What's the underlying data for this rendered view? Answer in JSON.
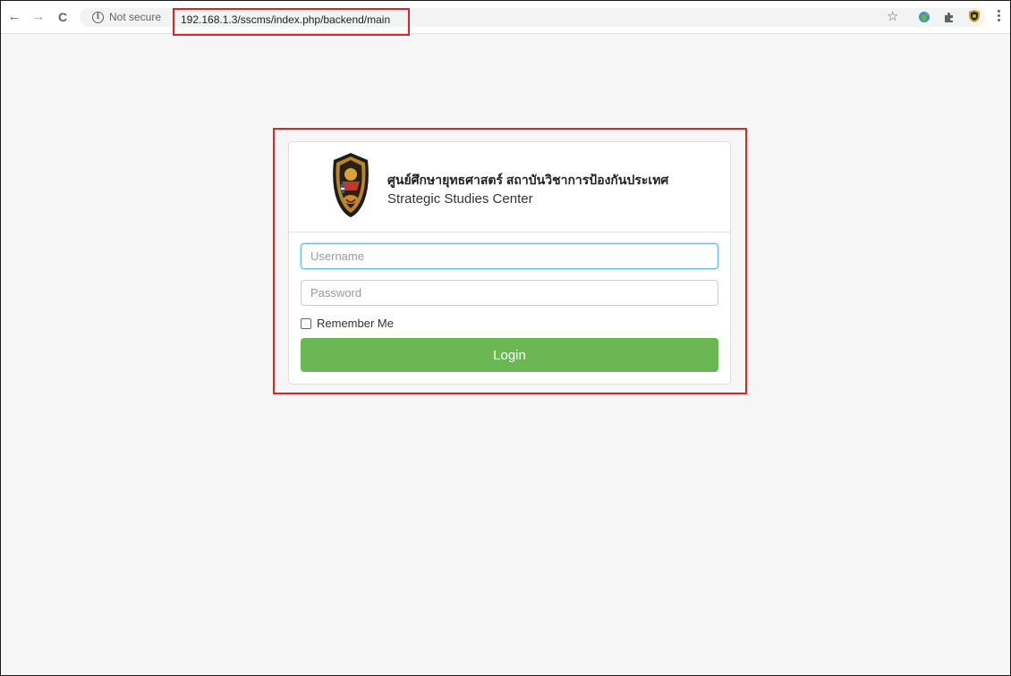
{
  "browser": {
    "security_label": "Not secure",
    "url": "192.168.1.3/sscms/index.php/backend/main",
    "nav": {
      "back": "←",
      "forward": "→",
      "reload": "C"
    }
  },
  "header": {
    "org_name_thai": "ศูนย์ศึกษายุทธศาสตร์ สถาบันวิชาการป้องกันประเทศ",
    "org_name_en": "Strategic Studies Center"
  },
  "form": {
    "username_placeholder": "Username",
    "password_placeholder": "Password",
    "remember_label": "Remember Me",
    "remember_checked": false,
    "login_label": "Login"
  },
  "colors": {
    "highlight": "#e02424",
    "login_button": "#6ab753"
  }
}
